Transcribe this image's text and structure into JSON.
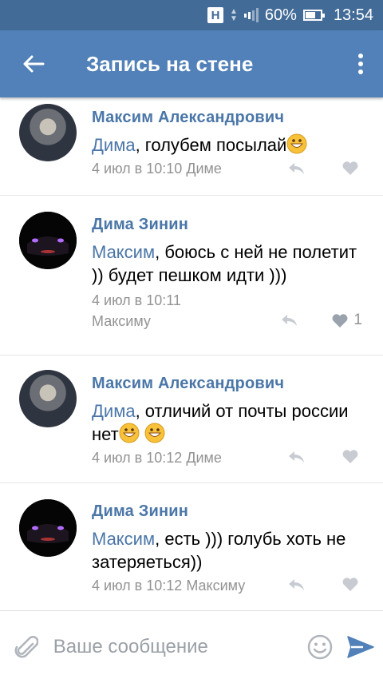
{
  "status": {
    "battery": "60%",
    "time": "13:54",
    "network_badge": "H"
  },
  "header": {
    "title": "Запись на стене",
    "back_icon": "arrow-left-icon",
    "menu_icon": "more-vert-icon"
  },
  "comments": [
    {
      "author": "Максим Александрович",
      "mention": "Дима",
      "text": ", голубем посылай",
      "emojis": 1,
      "date": "4 июл в 10:10",
      "reply_to": "Диме",
      "likes": ""
    },
    {
      "author": "Дима Зинин",
      "mention": "Максим",
      "text": ", боюсь с ней не полетит )) будет пешком идти )))",
      "emojis": 0,
      "date": "4 июл в 10:11",
      "reply_to": "Максиму",
      "likes": "1"
    },
    {
      "author": "Максим Александрович",
      "mention": "Дима",
      "text": ", отличий от почты россии нет",
      "emojis": 2,
      "date": "4 июл в 10:12",
      "reply_to": "Диме",
      "likes": ""
    },
    {
      "author": "Дима Зинин",
      "mention": "Максим",
      "text": ", есть ))) голубь хоть не затеряеться))",
      "emojis": 0,
      "date": "4 июл в 10:12",
      "reply_to": "Максиму",
      "likes": ""
    }
  ],
  "composer": {
    "placeholder": "Ваше сообщение"
  },
  "colors": {
    "statusbar": "#426b97",
    "appbar": "#5181b8",
    "link": "#4a76a8",
    "meta": "#939393"
  }
}
